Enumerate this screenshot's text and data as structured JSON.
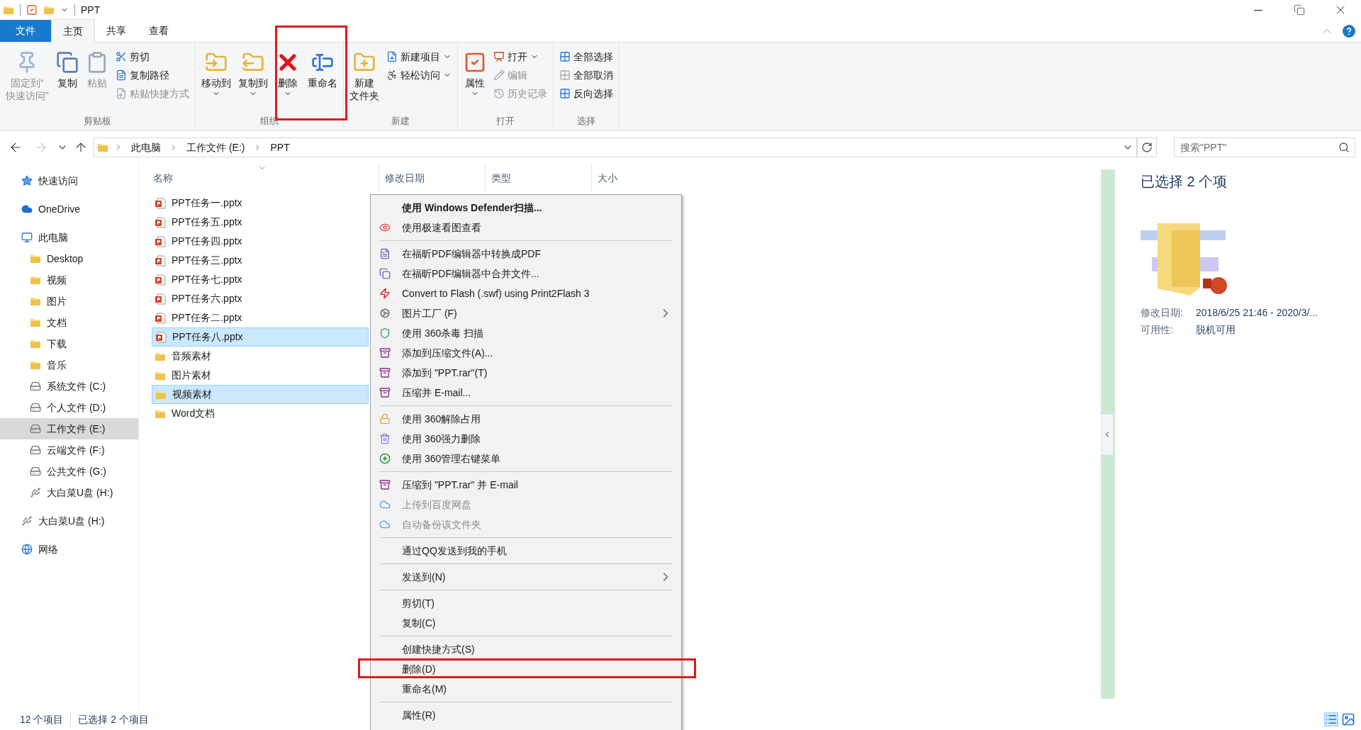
{
  "title_bar": {
    "title": "PPT"
  },
  "ribbon_tabs": [
    {
      "label": "文件",
      "kind": "file",
      "selected": false
    },
    {
      "label": "主页",
      "kind": "tab",
      "selected": true
    },
    {
      "label": "共享",
      "kind": "tab",
      "selected": false
    },
    {
      "label": "查看",
      "kind": "tab",
      "selected": false
    }
  ],
  "ribbon_groups": [
    {
      "label": "剪贴板",
      "large": [
        {
          "lines": [
            "固定到“",
            "快速访问”"
          ],
          "disabled": true,
          "dropdown": false
        },
        {
          "lines": [
            "复制"
          ],
          "disabled": false,
          "dropdown": false
        },
        {
          "lines": [
            "粘贴"
          ],
          "disabled": true,
          "dropdown": false
        }
      ],
      "small": [
        {
          "label": "剪切",
          "disabled": false,
          "dropdown": false
        },
        {
          "label": "复制路径",
          "disabled": false,
          "dropdown": false
        },
        {
          "label": "粘贴快捷方式",
          "disabled": true,
          "dropdown": false
        }
      ]
    },
    {
      "label": "组织",
      "large": [
        {
          "lines": [
            "移动到"
          ],
          "disabled": false,
          "dropdown": true
        },
        {
          "lines": [
            "复制到"
          ],
          "disabled": false,
          "dropdown": true
        },
        {
          "lines": [
            "删除"
          ],
          "disabled": false,
          "dropdown": true
        },
        {
          "lines": [
            "重命名"
          ],
          "disabled": false,
          "dropdown": false
        }
      ]
    },
    {
      "label": "新建",
      "large": [
        {
          "lines": [
            "新建",
            "文件夹"
          ],
          "disabled": false,
          "dropdown": false
        }
      ],
      "small": [
        {
          "label": "新建项目",
          "disabled": false,
          "dropdown": true
        },
        {
          "label": "轻松访问",
          "disabled": false,
          "dropdown": true
        }
      ]
    },
    {
      "label": "打开",
      "large": [
        {
          "lines": [
            "属性"
          ],
          "disabled": false,
          "dropdown": true
        }
      ],
      "small": [
        {
          "label": "打开",
          "disabled": false,
          "dropdown": true
        },
        {
          "label": "编辑",
          "disabled": true,
          "dropdown": false
        },
        {
          "label": "历史记录",
          "disabled": true,
          "dropdown": false
        }
      ]
    },
    {
      "label": "选择",
      "small": [
        {
          "label": "全部选择",
          "disabled": false,
          "dropdown": false
        },
        {
          "label": "全部取消",
          "disabled": false,
          "dropdown": false
        },
        {
          "label": "反向选择",
          "disabled": false,
          "dropdown": false
        }
      ]
    }
  ],
  "address": {
    "crumbs": [
      "此电脑",
      "工作文件 (E:)",
      "PPT"
    ],
    "search_placeholder": "搜索\"PPT\""
  },
  "nav": [
    {
      "label": "快速访问",
      "selected": false
    },
    {
      "label": "OneDrive",
      "selected": false
    },
    {
      "label": "此电脑",
      "selected": false,
      "children": [
        {
          "label": "Desktop",
          "selected": false
        },
        {
          "label": "视频",
          "selected": false
        },
        {
          "label": "图片",
          "selected": false
        },
        {
          "label": "文档",
          "selected": false
        },
        {
          "label": "下载",
          "selected": false
        },
        {
          "label": "音乐",
          "selected": false
        },
        {
          "label": "系统文件 (C:)",
          "selected": false
        },
        {
          "label": "个人文件 (D:)",
          "selected": false
        },
        {
          "label": "工作文件 (E:)",
          "selected": true
        },
        {
          "label": "云端文件 (F:)",
          "selected": false
        },
        {
          "label": "公共文件 (G:)",
          "selected": false
        },
        {
          "label": "大白菜U盘 (H:)",
          "selected": false
        }
      ]
    },
    {
      "label": "大白菜U盘 (H:)",
      "selected": false
    },
    {
      "label": "网络",
      "selected": false
    }
  ],
  "columns": [
    "名称",
    "修改日期",
    "类型",
    "大小"
  ],
  "files": [
    {
      "name": "PPT任务一.pptx",
      "kind": "pptx",
      "selected": false
    },
    {
      "name": "PPT任务五.pptx",
      "kind": "pptx",
      "selected": false
    },
    {
      "name": "PPT任务四.pptx",
      "kind": "pptx",
      "selected": false
    },
    {
      "name": "PPT任务三.pptx",
      "kind": "pptx",
      "selected": false
    },
    {
      "name": "PPT任务七.pptx",
      "kind": "pptx",
      "selected": false
    },
    {
      "name": "PPT任务六.pptx",
      "kind": "pptx",
      "selected": false
    },
    {
      "name": "PPT任务二.pptx",
      "kind": "pptx",
      "selected": false
    },
    {
      "name": "PPT任务八.pptx",
      "kind": "pptx",
      "selected": true
    },
    {
      "name": "音频素材",
      "kind": "folder",
      "selected": false
    },
    {
      "name": "图片素材",
      "kind": "folder",
      "selected": false
    },
    {
      "name": "视频素材",
      "kind": "folder",
      "selected": true
    },
    {
      "name": "Word文档",
      "kind": "folder",
      "selected": false
    }
  ],
  "context_menu": [
    [
      {
        "label": "使用 Windows Defender扫描...",
        "default": true,
        "disabled": false,
        "submenu": false
      },
      {
        "label": "使用极速看图查看",
        "default": false,
        "disabled": false,
        "submenu": false
      }
    ],
    [
      {
        "label": "在福昕PDF编辑器中转换成PDF",
        "default": false,
        "disabled": false,
        "submenu": false
      },
      {
        "label": "在福昕PDF编辑器中合并文件...",
        "default": false,
        "disabled": false,
        "submenu": false
      },
      {
        "label": "Convert to Flash (.swf) using Print2Flash 3",
        "default": false,
        "disabled": false,
        "submenu": false
      },
      {
        "label": "图片工厂 (F)",
        "default": false,
        "disabled": false,
        "submenu": true
      },
      {
        "label": "使用 360杀毒 扫描",
        "default": false,
        "disabled": false,
        "submenu": false
      },
      {
        "label": "添加到压缩文件(A)...",
        "default": false,
        "disabled": false,
        "submenu": false
      },
      {
        "label": "添加到 \"PPT.rar\"(T)",
        "default": false,
        "disabled": false,
        "submenu": false
      },
      {
        "label": "压缩并 E-mail...",
        "default": false,
        "disabled": false,
        "submenu": false
      }
    ],
    [
      {
        "label": "使用 360解除占用",
        "default": false,
        "disabled": false,
        "submenu": false
      },
      {
        "label": "使用 360强力删除",
        "default": false,
        "disabled": false,
        "submenu": false
      },
      {
        "label": "使用 360管理右键菜单",
        "default": false,
        "disabled": false,
        "submenu": false
      }
    ],
    [
      {
        "label": "压缩到 \"PPT.rar\" 并 E-mail",
        "default": false,
        "disabled": false,
        "submenu": false
      },
      {
        "label": "上传到百度网盘",
        "default": false,
        "disabled": true,
        "submenu": false
      },
      {
        "label": "自动备份该文件夹",
        "default": false,
        "disabled": true,
        "submenu": false
      }
    ],
    [
      {
        "label": "通过QQ发送到我的手机",
        "default": false,
        "disabled": false,
        "submenu": false
      }
    ],
    [
      {
        "label": "发送到(N)",
        "default": false,
        "disabled": false,
        "submenu": true
      }
    ],
    [
      {
        "label": "剪切(T)",
        "default": false,
        "disabled": false,
        "submenu": false
      },
      {
        "label": "复制(C)",
        "default": false,
        "disabled": false,
        "submenu": false
      }
    ],
    [
      {
        "label": "创建快捷方式(S)",
        "default": false,
        "disabled": false,
        "submenu": false
      },
      {
        "label": "删除(D)",
        "default": false,
        "disabled": false,
        "submenu": false
      },
      {
        "label": "重命名(M)",
        "default": false,
        "disabled": false,
        "submenu": false
      }
    ],
    [
      {
        "label": "属性(R)",
        "default": false,
        "disabled": false,
        "submenu": false
      }
    ]
  ],
  "details": {
    "title": "已选择 2 个项",
    "properties": [
      {
        "label": "修改日期:",
        "value": "2018/6/25 21:46 - 2020/3/..."
      },
      {
        "label": "可用性:",
        "value": "脱机可用"
      }
    ]
  },
  "status_bar": [
    "12 个项目",
    "已选择 2 个项目"
  ]
}
